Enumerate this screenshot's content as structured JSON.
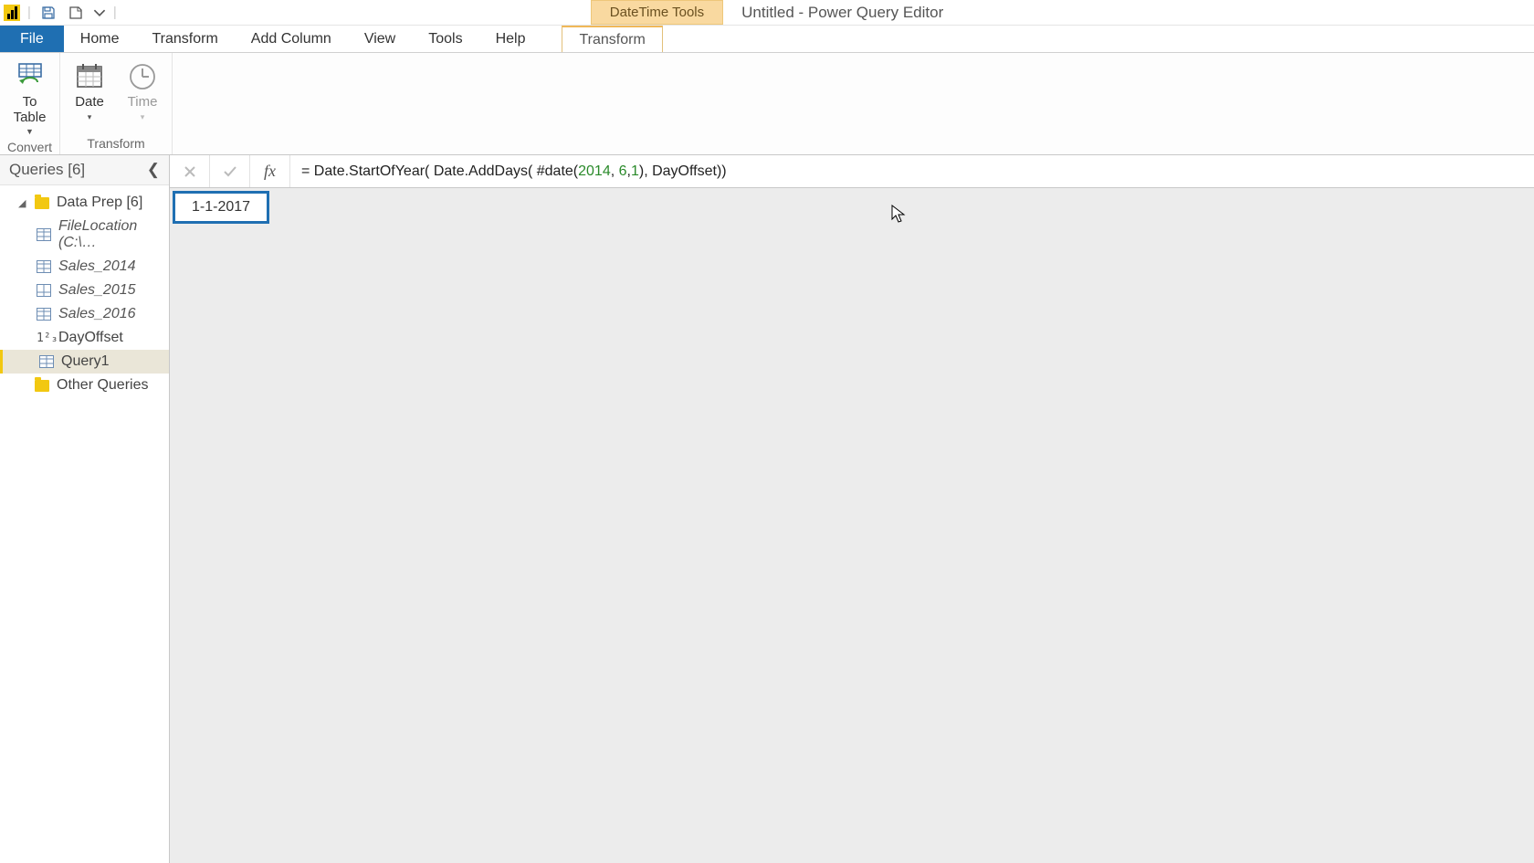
{
  "titlebar": {
    "ctx_header": "DateTime Tools",
    "window_title": "Untitled - Power Query Editor"
  },
  "tabs": {
    "file": "File",
    "home": "Home",
    "transform": "Transform",
    "add_column": "Add Column",
    "view": "View",
    "tools": "Tools",
    "help": "Help",
    "ctx_transform": "Transform"
  },
  "ribbon": {
    "convert": {
      "label": "Convert",
      "to_table": "To\nTable"
    },
    "transform": {
      "label": "Transform",
      "date": "Date",
      "time": "Time"
    }
  },
  "queries": {
    "header": "Queries [6]",
    "groups": [
      {
        "label": "Data Prep [6]",
        "items": [
          {
            "type": "table",
            "label": "FileLocation (C:\\…",
            "italic": true
          },
          {
            "type": "table",
            "label": "Sales_2014",
            "italic": true
          },
          {
            "type": "table",
            "label": "Sales_2015",
            "italic": true
          },
          {
            "type": "table",
            "label": "Sales_2016",
            "italic": true
          },
          {
            "type": "number",
            "label": "DayOffset",
            "italic": false
          },
          {
            "type": "table",
            "label": "Query1",
            "italic": false,
            "selected": true
          }
        ]
      },
      {
        "label": "Other Queries",
        "items": []
      }
    ]
  },
  "formula": {
    "prefix": "= Date.StartOfYear( Date.AddDays( #date(",
    "n1": "2014",
    "c1": ", ",
    "n2": "6",
    "c2": ",",
    "n3": "1",
    "suffix": "), DayOffset))"
  },
  "cell_value": "1-1-2017"
}
